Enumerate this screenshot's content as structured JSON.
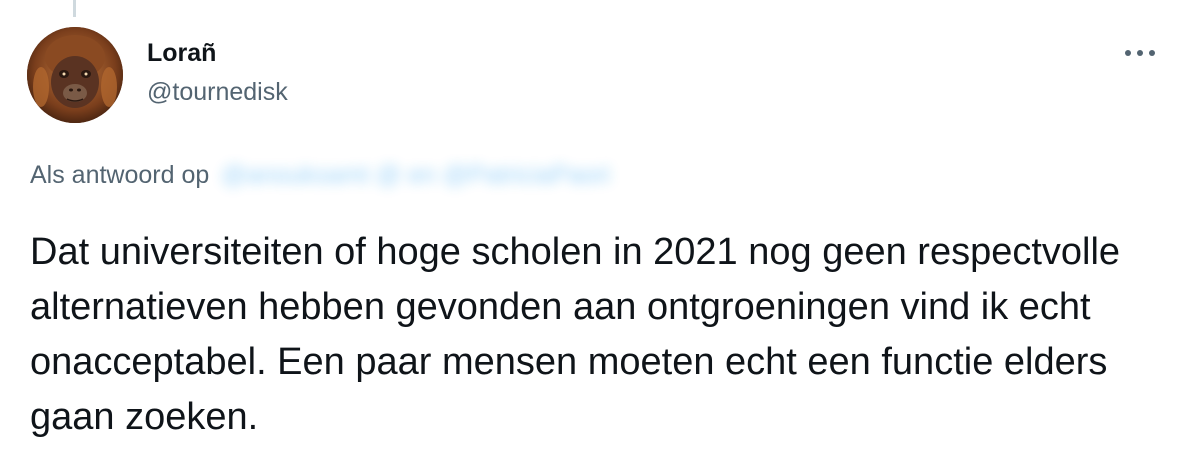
{
  "tweet": {
    "author": {
      "display_name": "Lorañ",
      "handle": "@tournedisk",
      "avatar_icon": "orangutan-avatar"
    },
    "more_icon": "more-horizontal-icon",
    "reply": {
      "label": "Als antwoord op",
      "target": "@anouksamt @ en @PatriciaPaori"
    },
    "text": "Dat universiteiten of hoge scholen in 2021 nog geen respectvolle alternatieven hebben gevonden aan ontgroeningen vind ik echt onacceptabel. Een paar mensen moeten echt een functie elders gaan zoeken."
  },
  "colors": {
    "text_primary": "#0f1419",
    "text_secondary": "#536471",
    "link": "#1d9bf0",
    "thread_line": "#cfd9de"
  }
}
